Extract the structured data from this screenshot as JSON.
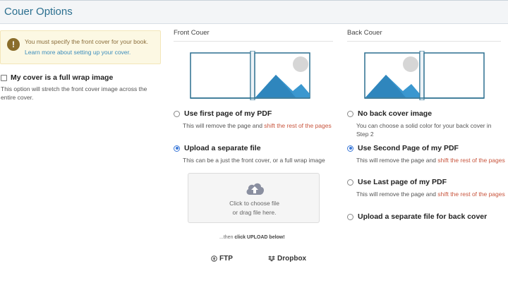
{
  "header": {
    "title": "Couer Options"
  },
  "alert": {
    "message": "You must specify the front cover for your book.",
    "link": "Learn more about setting up your cover."
  },
  "wrap": {
    "label": "My cover is a full wrap image",
    "description": "This option will stretch the front cover image across the entire cover.",
    "checked": false
  },
  "front": {
    "title": "Front Couer",
    "options": [
      {
        "label": "Use first page of my PDF",
        "desc_prefix": "This will remove the page and ",
        "desc_highlight": "shift the rest of the pages",
        "checked": false
      },
      {
        "label": "Upload a separate file",
        "desc": "This can be a just the front cover, or a full wrap image",
        "checked": true
      }
    ],
    "dropzone": {
      "line1": "Click to choose file",
      "line2": "or drag file here."
    }
  },
  "back": {
    "title": "Back Couer",
    "options": [
      {
        "label": "No back cover image",
        "desc": "You can choose a solid color for your back cover in Step 2",
        "checked": false
      },
      {
        "label": "Use Second Page of my PDF",
        "desc_prefix": "This will remove the page and ",
        "desc_highlight": "shift the rest of the pages",
        "checked": true
      },
      {
        "label": "Use Last page of my PDF",
        "desc_prefix": "This will remove the page and ",
        "desc_highlight": "shift the rest of the pages",
        "checked": false
      },
      {
        "label": "Upload a separate file for back cover",
        "checked": false
      }
    ]
  },
  "upload_hint": {
    "prefix": "...then ",
    "bold": "click UPLOAD below!"
  },
  "sources": {
    "ftp": "FTP",
    "dropbox": "Dropbox"
  },
  "colors": {
    "accent": "#2b6f8f",
    "highlight": "#c8553d",
    "image_blue": "#3a97cf",
    "radio_blue": "#3a78d8"
  }
}
